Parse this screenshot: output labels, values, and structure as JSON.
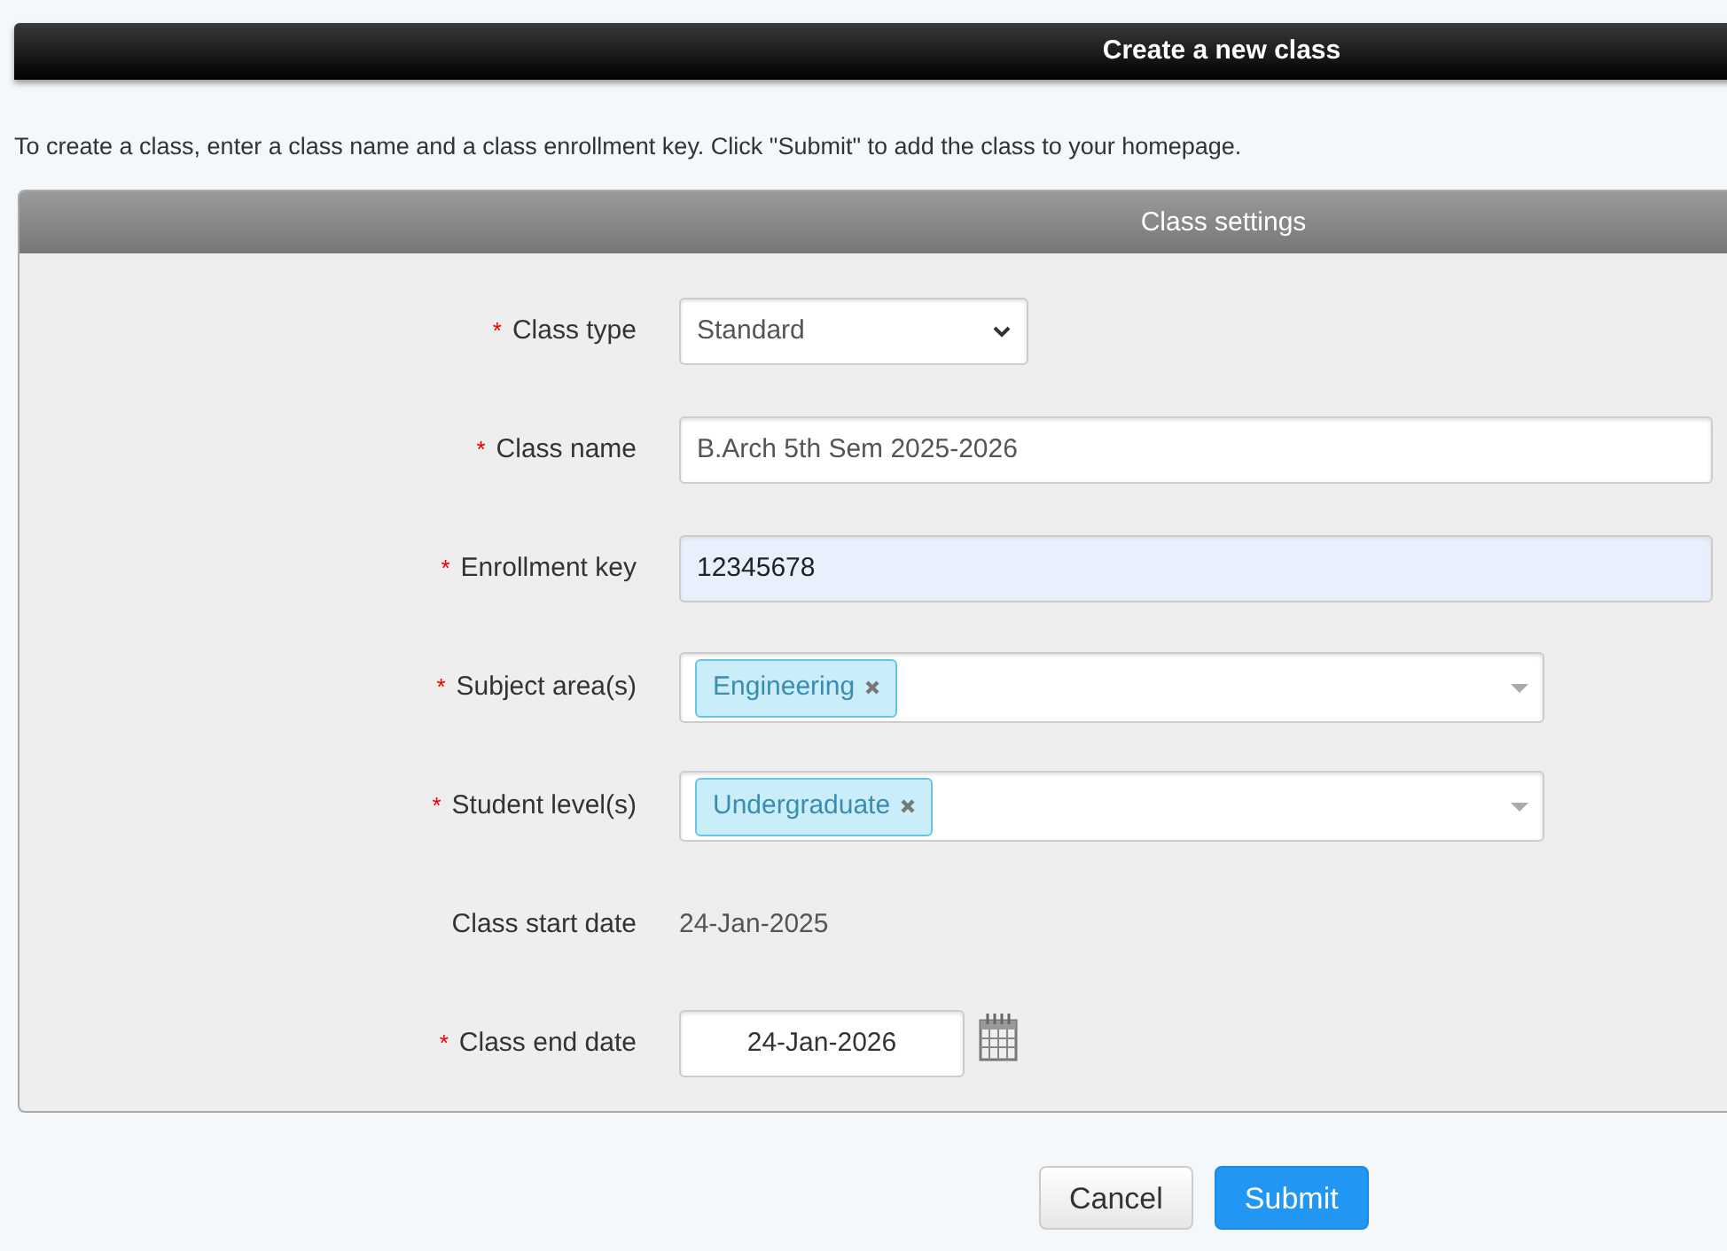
{
  "header": {
    "title": "Create a new class"
  },
  "intro": "To create a class, enter a class name and a class enrollment key. Click \"Submit\" to add the class to your homepage.",
  "panel": {
    "title": "Class settings",
    "fields": [
      {
        "kind": "select",
        "required_mark": "*",
        "label": "Class type",
        "value": "Standard"
      },
      {
        "kind": "text",
        "required_mark": "*",
        "label": "Class name",
        "value": "B.Arch 5th Sem 2025-2026",
        "autofilled": false
      },
      {
        "kind": "text",
        "required_mark": "*",
        "label": "Enrollment key",
        "value": "12345678",
        "autofilled": true
      },
      {
        "kind": "tags",
        "required_mark": "*",
        "label": "Subject area(s)",
        "tags": [
          "Engineering"
        ]
      },
      {
        "kind": "tags",
        "required_mark": "*",
        "label": "Student level(s)",
        "tags": [
          "Undergraduate"
        ]
      },
      {
        "kind": "static",
        "label": "Class start date",
        "value": "24-Jan-2025"
      },
      {
        "kind": "date",
        "required_mark": "*",
        "label": "Class end date",
        "value": "24-Jan-2026"
      }
    ]
  },
  "buttons": [
    {
      "label": "Cancel",
      "primary": false
    },
    {
      "label": "Submit",
      "primary": true
    }
  ]
}
